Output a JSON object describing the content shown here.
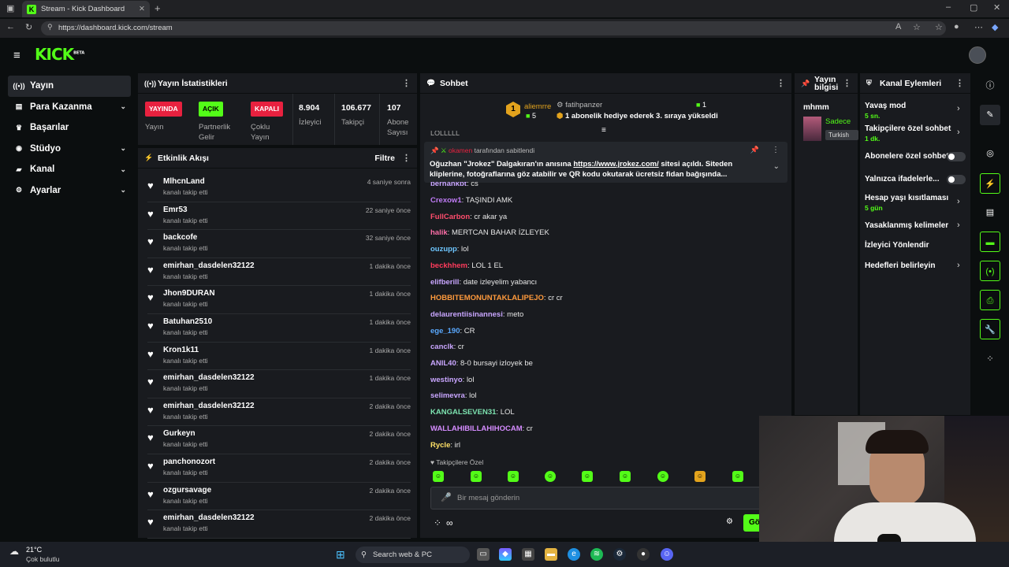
{
  "browser": {
    "tab_title": "Stream - Kick Dashboard",
    "url": "https://dashboard.kick.com/stream"
  },
  "logo": "KICK",
  "logo_badge": "BETA",
  "nav": [
    {
      "label": "Yayın",
      "icon": "broadcast-icon"
    },
    {
      "label": "Para Kazanma",
      "icon": "money-icon"
    },
    {
      "label": "Başarılar",
      "icon": "trophy-icon"
    },
    {
      "label": "Stüdyo",
      "icon": "studio-icon"
    },
    {
      "label": "Kanal",
      "icon": "channel-icon"
    },
    {
      "label": "Ayarlar",
      "icon": "settings-icon"
    }
  ],
  "stats": {
    "title": "Yayın İstatistikleri",
    "yayin": {
      "badge": "YAYINDA",
      "label": "Yayın"
    },
    "partner": {
      "badge": "AÇIK",
      "label1": "Partnerlik",
      "label2": "Gelir"
    },
    "coklu": {
      "badge": "KAPALI",
      "label1": "Çoklu",
      "label2": "Yayın"
    },
    "izleyici": {
      "value": "8.904",
      "label": "İzleyici"
    },
    "takipci": {
      "value": "106.677",
      "label": "Takipçi"
    },
    "abone": {
      "value": "107",
      "label1": "Abone",
      "label2": "Sayısı"
    }
  },
  "activity": {
    "title": "Etkinlik Akışı",
    "filter": "Filtre",
    "sub": "kanalı takip etti",
    "rows": [
      {
        "name": "MlhcnLand",
        "time": "4 saniye sonra"
      },
      {
        "name": "Emr53",
        "time": "22 saniye önce"
      },
      {
        "name": "backcofe",
        "time": "32 saniye önce"
      },
      {
        "name": "emirhan_dasdelen32122",
        "time": "1 dakika önce"
      },
      {
        "name": "Jhon9DURAN",
        "time": "1 dakika önce"
      },
      {
        "name": "Batuhan2510",
        "time": "1 dakika önce"
      },
      {
        "name": "Kron1k11",
        "time": "1 dakika önce"
      },
      {
        "name": "emirhan_dasdelen32122",
        "time": "1 dakika önce"
      },
      {
        "name": "emirhan_dasdelen32122",
        "time": "2 dakika önce"
      },
      {
        "name": "Gurkeyn",
        "time": "2 dakika önce"
      },
      {
        "name": "panchonozort",
        "time": "2 dakika önce"
      },
      {
        "name": "ozgursavage",
        "time": "2 dakika önce"
      },
      {
        "name": "emirhan_dasdelen32122",
        "time": "2 dakika önce"
      }
    ]
  },
  "chat": {
    "title": "Sohbet",
    "gift": {
      "rank": "1",
      "user": "aliemrre",
      "count": "5",
      "gifter": "fatihpanzer",
      "gifter_count": "1",
      "text": "1 abonelik hediye ederek 3. sıraya yükseldi"
    },
    "pinned": {
      "by": "okamen",
      "by_suffix": "tarafından sabitlendi",
      "text1": "Oğuzhan \"Jrokez\" Dalgakıran'ın anısına ",
      "link": "https://www.jrokez.com/",
      "text2": " sitesi açıldı. Siteden",
      "text3": "kliplerine, fotoğraflarına göz atabilir ve QR kodu okutarak ücretsiz fidan bağışında..."
    },
    "partial_top": "LOLLLLL",
    "partial_user": "berhankbt",
    "partial_text": "cs",
    "messages": [
      {
        "user": "Crexow1",
        "text": "TAŞINDI AMK",
        "color": "#c07cf6"
      },
      {
        "user": "FullCarbon",
        "text": "cr akar ya",
        "color": "#ff4d6d"
      },
      {
        "user": "halik",
        "text": "MERTCAN BAHAR İZLEYEK",
        "color": "#ff6fa8"
      },
      {
        "user": "ouzupp",
        "text": "lol",
        "color": "#6ec6ff"
      },
      {
        "user": "beckhhem",
        "text": "LOL 1 EL",
        "color": "#ff3b5c"
      },
      {
        "user": "elifberill",
        "text": "date izleyelim yabancı",
        "color": "#c9a6ff"
      },
      {
        "user": "HOBBITEMONUNTAKLALIPEJO",
        "text": "cr cr",
        "color": "#ff9a3c"
      },
      {
        "user": "delaurentiisinannesi",
        "text": "meto",
        "color": "#c9a6ff"
      },
      {
        "user": "ege_190",
        "text": "CR",
        "color": "#5aa9ff"
      },
      {
        "user": "canclk",
        "text": "cr",
        "color": "#c9a6ff"
      },
      {
        "user": "ANIL40",
        "text": "8-0 bursayi izloyek be",
        "color": "#c9a6ff"
      },
      {
        "user": "westinyo",
        "text": "lol",
        "color": "#c9a6ff"
      },
      {
        "user": "selimevra",
        "text": "lol",
        "color": "#c9a6ff"
      },
      {
        "user": "KANGALSEVEN31",
        "text": "LOL",
        "color": "#7de3b0"
      },
      {
        "user": "WALLAHIBILLAHIHOCAM",
        "text": "cr",
        "color": "#d58cff"
      },
      {
        "user": "Rycle",
        "text": "irl",
        "color": "#ffe066"
      }
    ],
    "followers_only": "Takipçilere Özel",
    "input_placeholder": "Bir mesaj gönderin",
    "send": "Gö"
  },
  "info": {
    "title1": "Yayın",
    "title2": "bilgisi",
    "name": "mhmm",
    "desc": "Sadece",
    "lang": "Turkish"
  },
  "actions": {
    "title": "Kanal Eylemleri",
    "slow": {
      "label": "Yavaş mod",
      "sub": "5 sn."
    },
    "followers": {
      "label": "Takipçilere özel sohbet",
      "sub": "1 dk."
    },
    "subs": {
      "label": "Abonelere özel sohbet"
    },
    "emotes": {
      "label": "Yalnızca ifadelerle..."
    },
    "age": {
      "label": "Hesap yaşı kısıtlaması",
      "sub": "5 gün"
    },
    "banned": {
      "label": "Yasaklanmış kelimeler"
    },
    "redirect": {
      "label": "İzleyici Yönlendir"
    },
    "targets": {
      "label": "Hedefleri belirleyin"
    }
  },
  "taskbar": {
    "weather_temp": "21°C",
    "weather_desc": "Çok bulutlu",
    "search": "Search web & PC"
  },
  "colors": {
    "accent": "#53fc18",
    "panel": "#191b1f",
    "bg": "#0b0e0f"
  }
}
